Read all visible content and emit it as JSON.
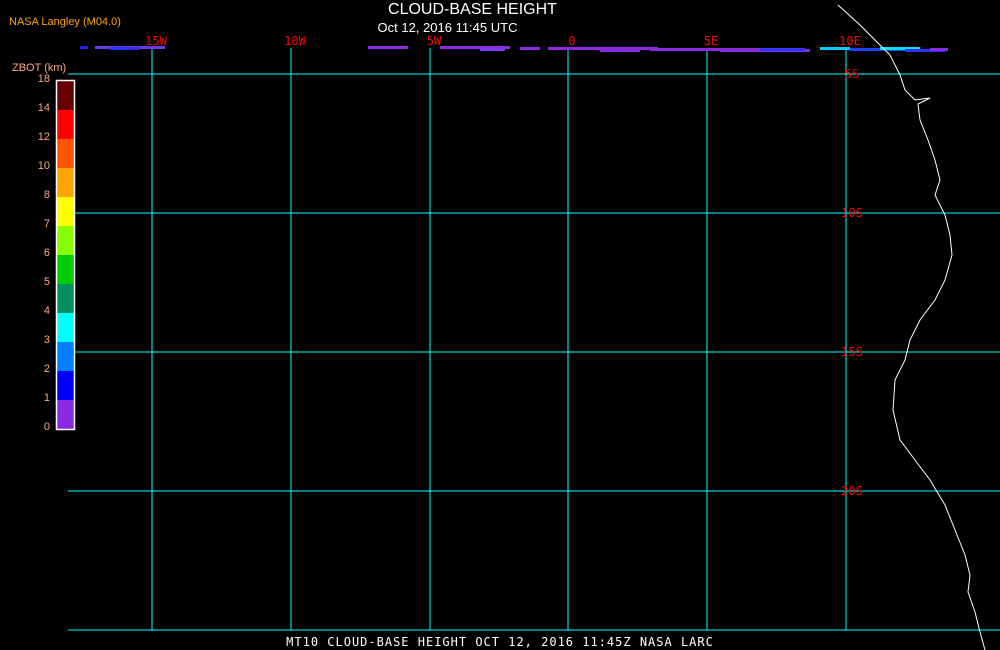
{
  "header": {
    "title": "CLOUD-BASE HEIGHT",
    "subtitle": "Oct 12, 2016 11:45 UTC",
    "organization": "NASA Langley (M04.0)"
  },
  "colorbar": {
    "title": "ZBOT (km)",
    "labels": [
      "18",
      "14",
      "12",
      "10",
      "8",
      "7",
      "6",
      "5",
      "4",
      "3",
      "2",
      "1",
      "0"
    ],
    "colors": [
      "#660000",
      "#ff0000",
      "#ff5500",
      "#ffa500",
      "#ffff00",
      "#88ff00",
      "#00cc00",
      "#009060",
      "#00ffff",
      "#0080ff",
      "#0000ff",
      "#8a2be2"
    ]
  },
  "map": {
    "longitude_labels": [
      "15W",
      "10W",
      "5W",
      "0",
      "5E",
      "10E"
    ],
    "latitude_labels": [
      "5S",
      "10S",
      "15S",
      "20S"
    ],
    "grid_color": "#00ffff",
    "label_color": "#ff0000",
    "coastline_color": "#ffffff"
  },
  "footer": {
    "text": "MT10  CLOUD-BASE HEIGHT   OCT 12, 2016 11:45Z   NASA LARC"
  }
}
